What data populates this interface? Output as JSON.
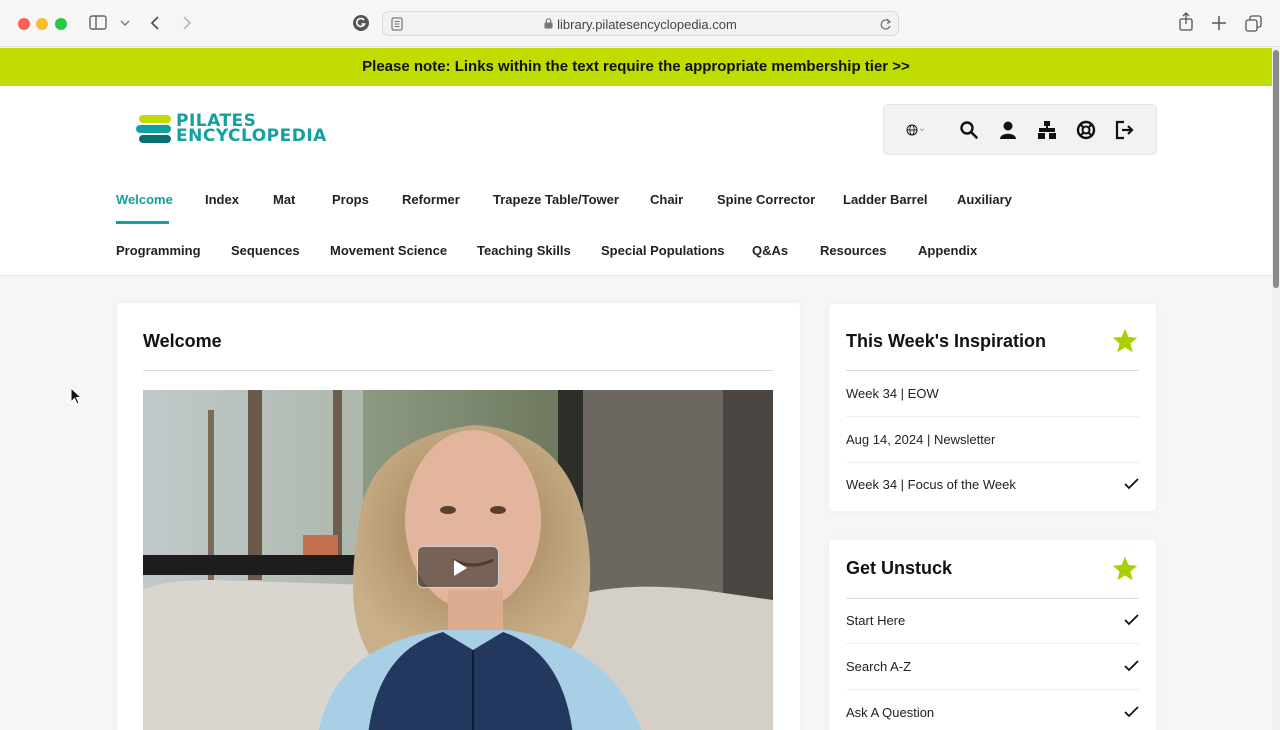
{
  "browser": {
    "url": "library.pilatesencyclopedia.com"
  },
  "notice": "Please note: Links within the text require the appropriate membership tier >>",
  "logo": {
    "line1": "PILATES",
    "line2": "ENCYCLOPEDIA"
  },
  "nav_row1": [
    {
      "label": "Welcome",
      "active": true
    },
    {
      "label": "Index"
    },
    {
      "label": "Mat"
    },
    {
      "label": "Props"
    },
    {
      "label": "Reformer"
    },
    {
      "label": "Trapeze Table/Tower"
    },
    {
      "label": "Chair"
    },
    {
      "label": "Spine Corrector"
    },
    {
      "label": "Ladder Barrel"
    },
    {
      "label": "Auxiliary"
    }
  ],
  "nav_row2": [
    {
      "label": "Programming"
    },
    {
      "label": "Sequences"
    },
    {
      "label": "Movement Science"
    },
    {
      "label": "Teaching Skills"
    },
    {
      "label": "Special Populations"
    },
    {
      "label": "Q&As"
    },
    {
      "label": "Resources"
    },
    {
      "label": "Appendix"
    }
  ],
  "main": {
    "title": "Welcome"
  },
  "inspiration": {
    "title": "This Week's Inspiration",
    "items": [
      {
        "label": "Week 34 | EOW",
        "checked": false
      },
      {
        "label": "Aug 14, 2024 | Newsletter",
        "checked": false
      },
      {
        "label": "Week 34 | Focus of the Week",
        "checked": true
      }
    ]
  },
  "unstuck": {
    "title": "Get Unstuck",
    "items": [
      {
        "label": "Start Here",
        "checked": true
      },
      {
        "label": "Search A-Z",
        "checked": true
      },
      {
        "label": "Ask A Question",
        "checked": true
      }
    ]
  },
  "icons": {
    "toolbar": [
      "globe-icon",
      "search-icon",
      "user-icon",
      "sitemap-icon",
      "support-icon",
      "logout-icon"
    ]
  },
  "colors": {
    "accent": "#13a0a0",
    "notice_bg": "#c0dc00",
    "star": "#a8d000"
  }
}
